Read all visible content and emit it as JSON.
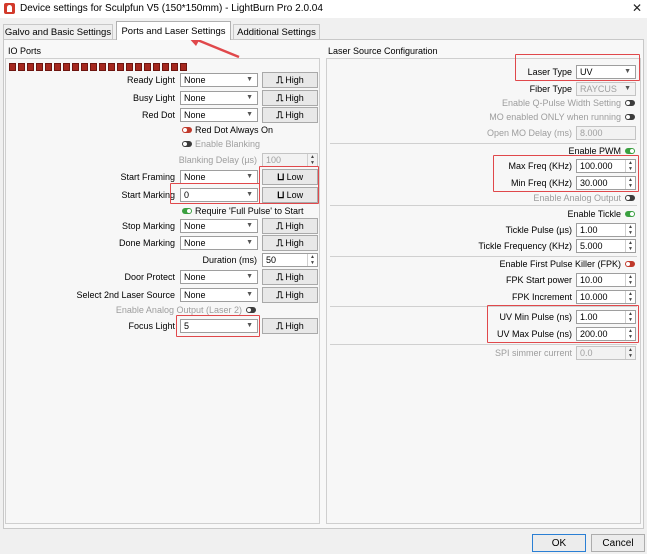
{
  "window": {
    "title": "Device settings for Sculpfun V5  (150*150mm)  - LightBurn Pro 2.0.04",
    "close_glyph": "✕"
  },
  "tabs": [
    {
      "label": "Galvo and Basic Settings"
    },
    {
      "label": "Ports and Laser Settings"
    },
    {
      "label": "Additional Settings"
    }
  ],
  "io_ports": {
    "title": "IO Ports",
    "led_count": 20,
    "ready_light": {
      "label": "Ready Light",
      "value": "None",
      "polarity": "High"
    },
    "busy_light": {
      "label": "Busy Light",
      "value": "None",
      "polarity": "High"
    },
    "red_dot": {
      "label": "Red Dot",
      "value": "None",
      "polarity": "High"
    },
    "red_dot_always_on": {
      "label": "Red Dot Always On",
      "state": "off"
    },
    "enable_blanking": {
      "label": "Enable Blanking",
      "state": "off"
    },
    "blanking_delay": {
      "label": "Blanking Delay (µs)",
      "value": "100"
    },
    "start_framing": {
      "label": "Start Framing",
      "value": "None",
      "polarity": "Low"
    },
    "start_marking": {
      "label": "Start Marking",
      "value": "0",
      "polarity": "Low"
    },
    "require_full_pulse": {
      "label": "Require 'Full Pulse' to Start",
      "state": "on"
    },
    "stop_marking": {
      "label": "Stop Marking",
      "value": "None",
      "polarity": "High"
    },
    "done_marking": {
      "label": "Done Marking",
      "value": "None",
      "polarity": "High"
    },
    "duration": {
      "label": "Duration (ms)",
      "value": "50"
    },
    "door_protect": {
      "label": "Door Protect",
      "value": "None",
      "polarity": "High"
    },
    "select_2nd_laser": {
      "label": "Select 2nd Laser Source",
      "value": "None",
      "polarity": "High"
    },
    "enable_analog_output_laser2": {
      "label": "Enable Analog Output (Laser 2)",
      "state": "off"
    },
    "focus_light": {
      "label": "Focus Light",
      "value": "5",
      "polarity": "High"
    }
  },
  "laser_source": {
    "title": "Laser Source Configuration",
    "laser_type": {
      "label": "Laser Type",
      "value": "UV"
    },
    "fiber_type": {
      "label": "Fiber Type",
      "value": "RAYCUS"
    },
    "enable_q_pulse": {
      "label": "Enable Q-Pulse Width Setting",
      "state": "off"
    },
    "mo_enabled": {
      "label": "MO enabled ONLY when running",
      "state": "off"
    },
    "open_mo_delay": {
      "label": "Open MO Delay (ms)",
      "value": "8.000"
    },
    "enable_pwm": {
      "label": "Enable PWM",
      "state": "on"
    },
    "max_freq": {
      "label": "Max Freq (KHz)",
      "value": "100.000"
    },
    "min_freq": {
      "label": "Min Freq (KHz)",
      "value": "30.000"
    },
    "enable_analog_output": {
      "label": "Enable Analog Output",
      "state": "off"
    },
    "enable_tickle": {
      "label": "Enable Tickle",
      "state": "on"
    },
    "tickle_pulse": {
      "label": "Tickle Pulse (µs)",
      "value": "1.00"
    },
    "tickle_frequency": {
      "label": "Tickle Frequency (KHz)",
      "value": "5.000"
    },
    "enable_fpk": {
      "label": "Enable First Pulse Killer (FPK)",
      "state": "off-red"
    },
    "fpk_start_power": {
      "label": "FPK Start power",
      "value": "10.00"
    },
    "fpk_increment": {
      "label": "FPK Increment",
      "value": "10.000"
    },
    "uv_min_pulse": {
      "label": "UV Min Pulse (ns)",
      "value": "1.00"
    },
    "uv_max_pulse": {
      "label": "UV Max Pulse (ns)",
      "value": "200.00"
    },
    "spi_simmer_current": {
      "label": "SPI simmer current",
      "value": "0.0"
    }
  },
  "buttons": {
    "ok": "OK",
    "cancel": "Cancel"
  },
  "glyphs": {
    "dropdown": "▼",
    "spin_up": "▲",
    "spin_down": "▼",
    "pulse_high": "⎍",
    "pulse_low": "⊔"
  },
  "colors": {
    "highlight": "#e0484b",
    "led": "#a5281f",
    "toggle_on": "#3aa040",
    "toggle_off": "#3c3c3c",
    "toggle_red": "#c0392b"
  }
}
